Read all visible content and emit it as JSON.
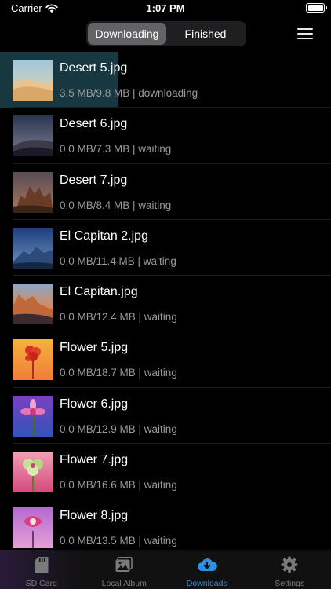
{
  "status_bar": {
    "carrier": "Carrier",
    "time": "1:07 PM"
  },
  "segment": {
    "tabs": [
      "Downloading",
      "Finished"
    ],
    "selected": 0
  },
  "menu_icon": "hamburger-menu-icon",
  "downloads": [
    {
      "name": "Desert 5.jpg",
      "meta": "3.5 MB/9.8 MB | downloading",
      "progress": 0.357,
      "thumb": "desert-dunes-day"
    },
    {
      "name": "Desert 6.jpg",
      "meta": "0.0 MB/7.3 MB | waiting",
      "thumb": "desert-dunes-night"
    },
    {
      "name": "Desert 7.jpg",
      "meta": "0.0 MB/8.4 MB | waiting",
      "thumb": "desert-rocks-dusk"
    },
    {
      "name": "El Capitan 2.jpg",
      "meta": "0.0 MB/11.4 MB | waiting",
      "thumb": "mountain-blue"
    },
    {
      "name": "El Capitan.jpg",
      "meta": "0.0 MB/12.4 MB | waiting",
      "thumb": "mountain-sunset"
    },
    {
      "name": "Flower 5.jpg",
      "meta": "0.0 MB/18.7 MB | waiting",
      "thumb": "flower-red-on-orange"
    },
    {
      "name": "Flower 6.jpg",
      "meta": "0.0 MB/12.9 MB | waiting",
      "thumb": "flower-pink-on-purple"
    },
    {
      "name": "Flower 7.jpg",
      "meta": "0.0 MB/16.6 MB | waiting",
      "thumb": "flower-green-on-pink"
    },
    {
      "name": "Flower 8.jpg",
      "meta": "0.0 MB/13.5 MB | waiting",
      "thumb": "flower-pink-on-violet"
    }
  ],
  "tabbar": {
    "items": [
      {
        "label": "SD Card",
        "icon": "sd-card-icon"
      },
      {
        "label": "Local Album",
        "icon": "photo-album-icon"
      },
      {
        "label": "Downloads",
        "icon": "cloud-download-icon"
      },
      {
        "label": "Settings",
        "icon": "gear-icon"
      }
    ],
    "selected": 2
  },
  "colors": {
    "accent": "#2f8fe0",
    "progress": "#173841",
    "meta_text": "#9a9a9a"
  }
}
